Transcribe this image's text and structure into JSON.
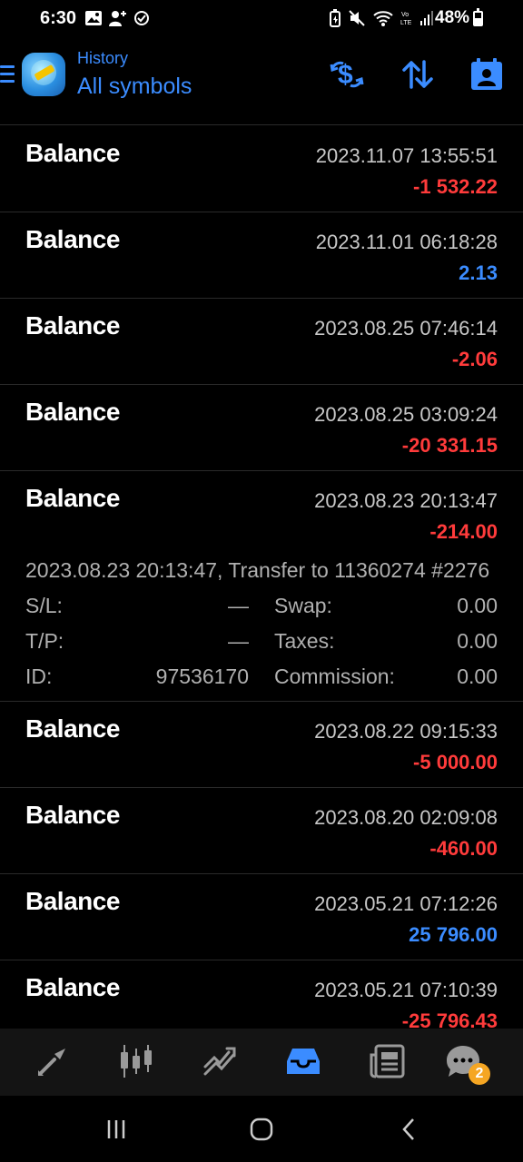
{
  "status": {
    "time": "6:30",
    "battery": "48%"
  },
  "header": {
    "subtitle": "History",
    "title": "All symbols",
    "icons": [
      "deposit-filter-icon",
      "sort-icon",
      "calendar-period-icon"
    ]
  },
  "rows": [
    {
      "label": "Balance",
      "date": "2023.11.07 13:55:51",
      "amount": "-1 532.22",
      "sign": "neg"
    },
    {
      "label": "Balance",
      "date": "2023.11.01 06:18:28",
      "amount": "2.13",
      "sign": "pos"
    },
    {
      "label": "Balance",
      "date": "2023.08.25 07:46:14",
      "amount": "-2.06",
      "sign": "neg"
    },
    {
      "label": "Balance",
      "date": "2023.08.25 03:09:24",
      "amount": "-20 331.15",
      "sign": "neg"
    },
    {
      "label": "Balance",
      "date": "2023.08.23 20:13:47",
      "amount": "-214.00",
      "sign": "neg"
    },
    {
      "label": "Balance",
      "date": "2023.08.22 09:15:33",
      "amount": "-5 000.00",
      "sign": "neg"
    },
    {
      "label": "Balance",
      "date": "2023.08.20 02:09:08",
      "amount": "-460.00",
      "sign": "neg"
    },
    {
      "label": "Balance",
      "date": "2023.05.21 07:12:26",
      "amount": "25 796.00",
      "sign": "pos"
    },
    {
      "label": "Balance",
      "date": "2023.05.21 07:10:39",
      "amount": "-25 796.43",
      "sign": "neg"
    }
  ],
  "expanded": {
    "comment": "2023.08.23 20:13:47, Transfer to 11360274 #2276",
    "sl_label": "S/L:",
    "sl_value": "—",
    "tp_label": "T/P:",
    "tp_value": "—",
    "id_label": "ID:",
    "id_value": "97536170",
    "swap_label": "Swap:",
    "swap_value": "0.00",
    "taxes_label": "Taxes:",
    "taxes_value": "0.00",
    "commission_label": "Commission:",
    "commission_value": "0.00"
  },
  "tabbar": {
    "tabs": [
      "quotes-icon",
      "chart-icon",
      "trade-icon",
      "history-icon",
      "news-icon",
      "chat-icon"
    ],
    "active": "history-icon",
    "chat_badge": "2"
  },
  "colors": {
    "accent": "#3b8cff",
    "negative": "#ff3b3b",
    "badge": "#f5a623"
  }
}
